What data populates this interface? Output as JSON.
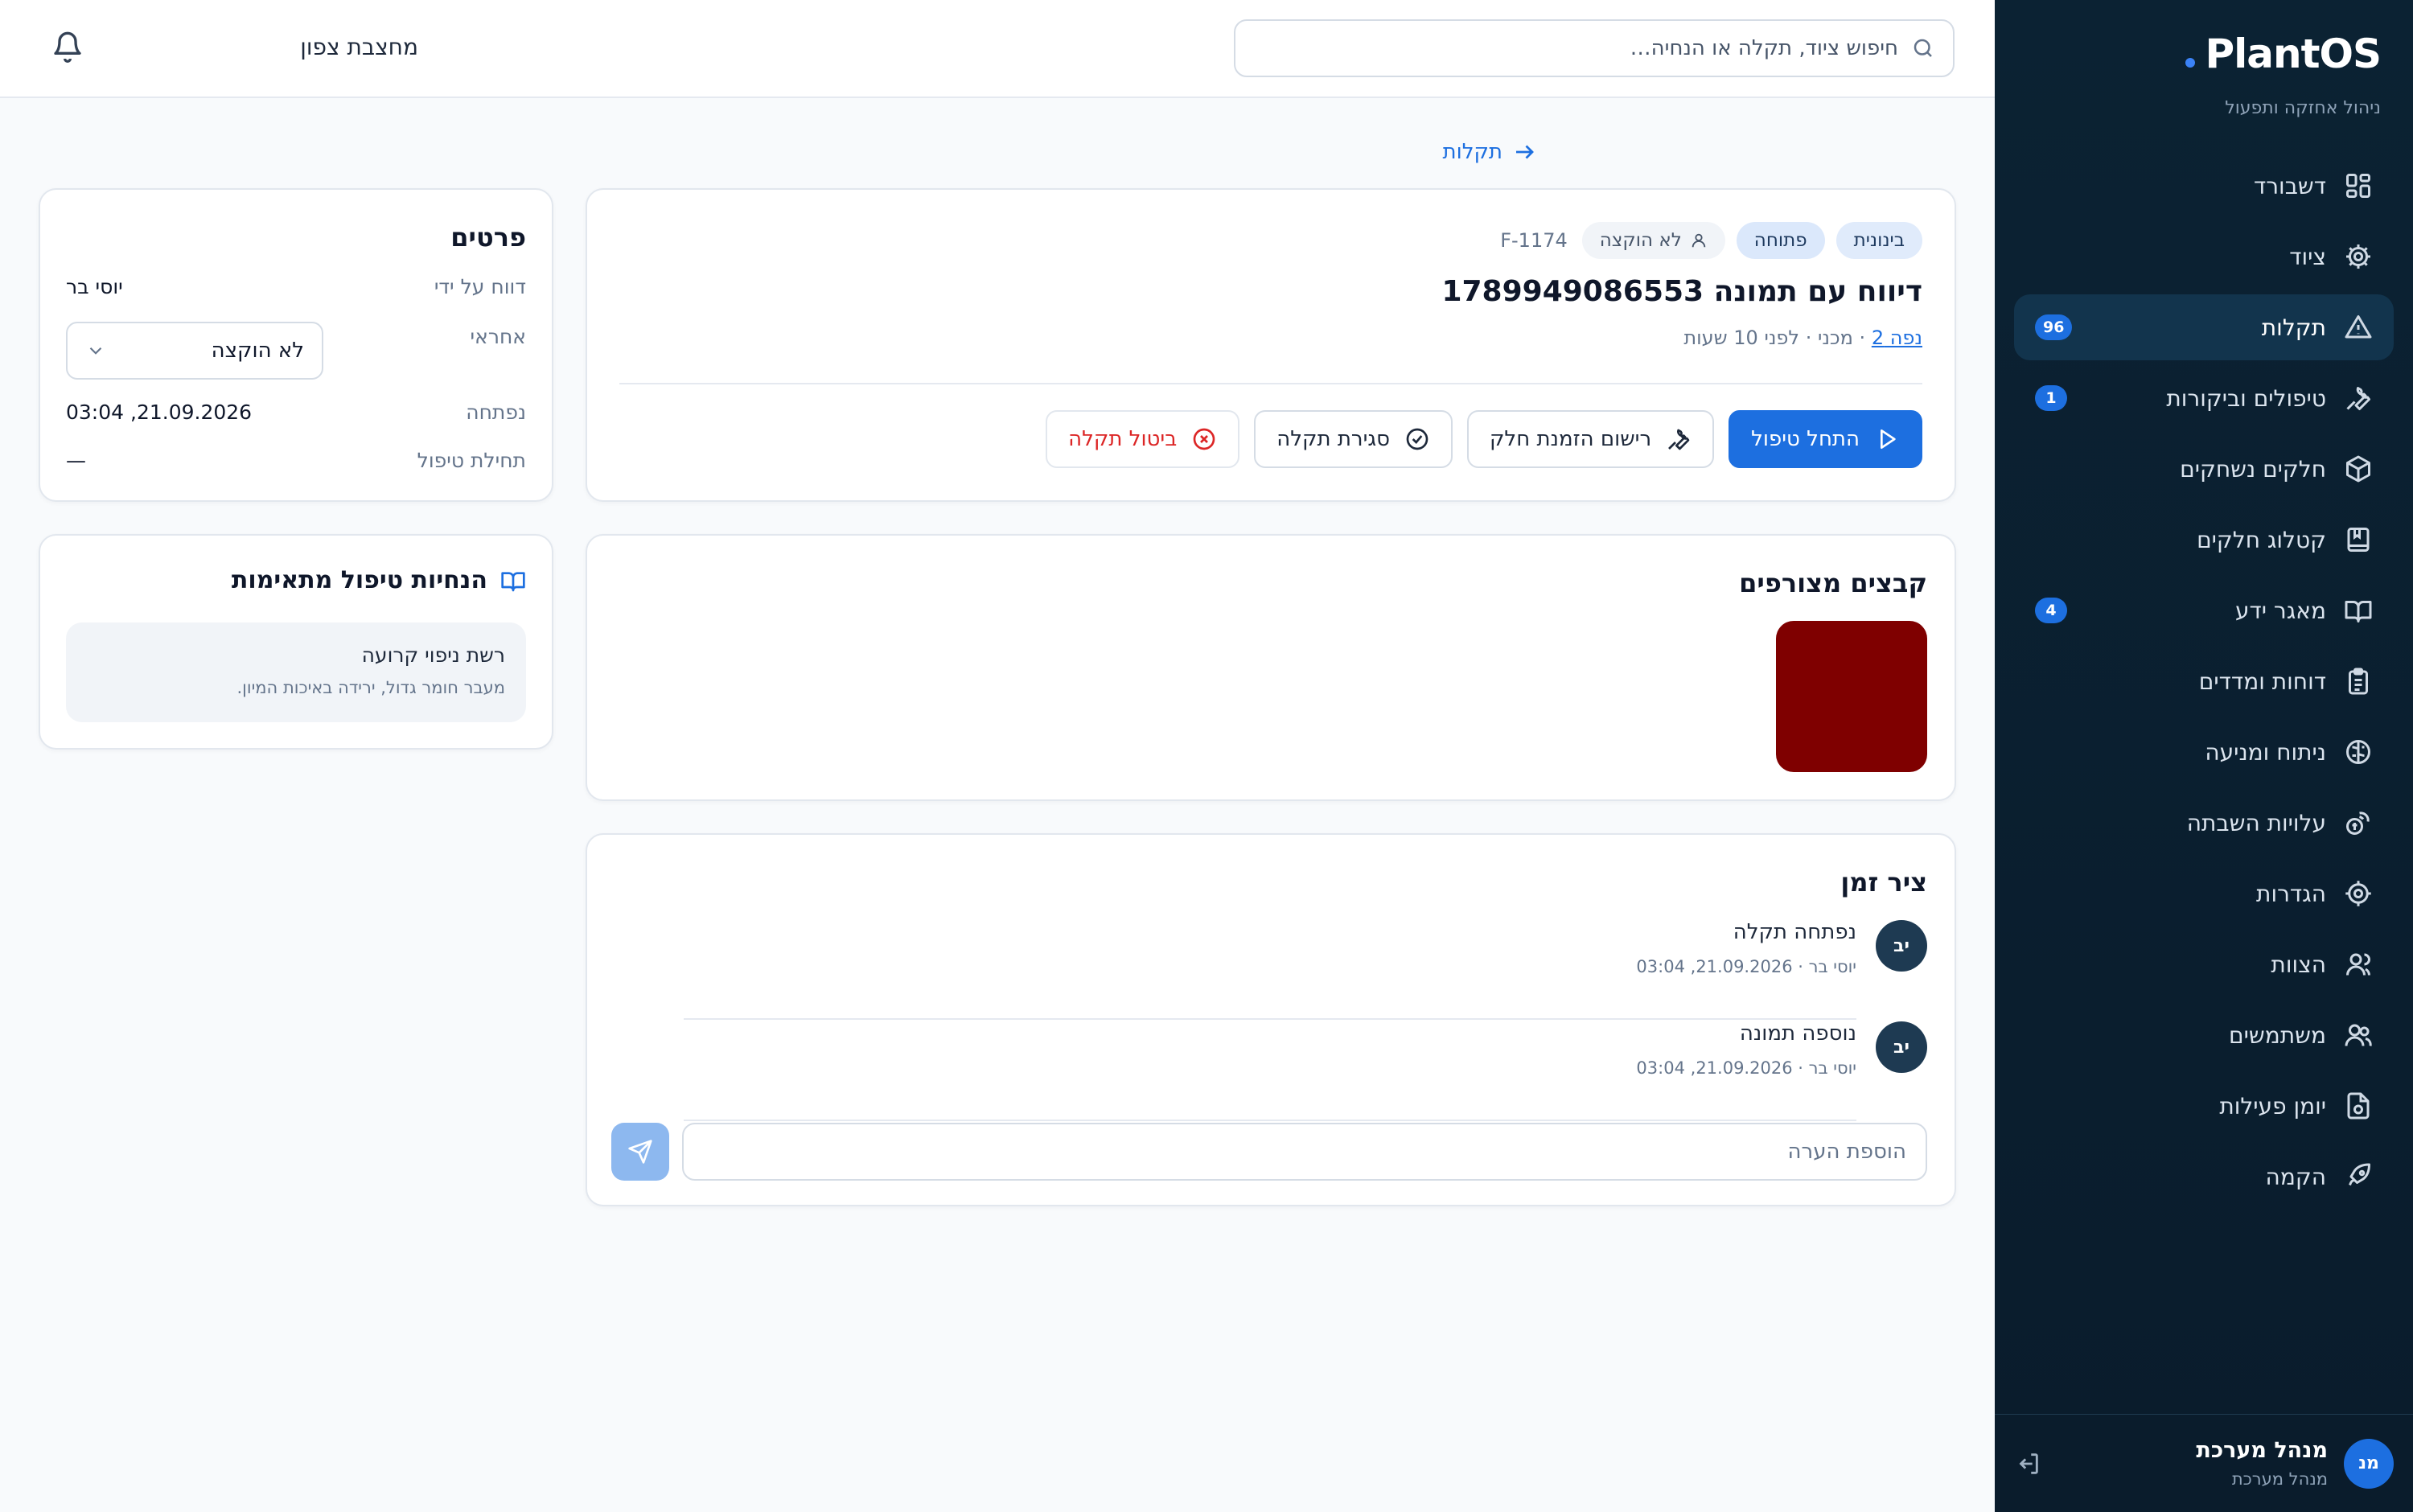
{
  "sidebar": {
    "brand": "PlantOS",
    "subtitle": "ניהול אחזקה ותפעול",
    "items": [
      {
        "label": "דשבורד",
        "icon": "dashboard-icon",
        "badge": ""
      },
      {
        "label": "ציוד",
        "icon": "gear-icon",
        "badge": ""
      },
      {
        "label": "תקלות",
        "icon": "warning-icon",
        "badge": "96",
        "active": true
      },
      {
        "label": "טיפולים וביקורות",
        "icon": "wrench-icon",
        "badge": "1"
      },
      {
        "label": "חלקים נשחקים",
        "icon": "box-icon",
        "badge": ""
      },
      {
        "label": "קטלוג חלקים",
        "icon": "book-icon",
        "badge": ""
      },
      {
        "label": "מאגר ידע",
        "icon": "open-book-icon",
        "badge": "4"
      },
      {
        "label": "דוחות ומדדים",
        "icon": "clipboard-icon",
        "badge": ""
      },
      {
        "label": "ניתוח ומניעה",
        "icon": "brain-icon",
        "badge": ""
      },
      {
        "label": "עלויות השבתה",
        "icon": "coins-icon",
        "badge": ""
      },
      {
        "label": "הגדרות",
        "icon": "settings-icon",
        "badge": ""
      },
      {
        "label": "הצוות",
        "icon": "user-icon",
        "badge": ""
      },
      {
        "label": "משתמשים",
        "icon": "users-icon",
        "badge": ""
      },
      {
        "label": "יומן פעילות",
        "icon": "activity-log-icon",
        "badge": ""
      },
      {
        "label": "הקמה",
        "icon": "rocket-icon",
        "badge": ""
      }
    ],
    "user": {
      "initials": "מנ",
      "name": "מנהל מערכת",
      "role": "מנהל מערכת"
    }
  },
  "topbar": {
    "search_placeholder": "חיפוש ציוד, תקלה או הנחיה…",
    "site": "מחצבת צפון"
  },
  "back_link": "תקלות",
  "fault": {
    "priority": "בינונית",
    "status": "פתוחה",
    "assignee": "לא הוקצה",
    "id": "F-1174",
    "title": "דיווח עם תמונה 1789949086553",
    "meta_link": "נפה 2",
    "meta_rest": " · מכני · לפני 10 שעות",
    "actions": {
      "start": "התחל טיפול",
      "order_part": "רישום הזמנת חלק",
      "close": "סגירת תקלה",
      "cancel": "ביטול תקלה"
    }
  },
  "files": {
    "title": "קבצים מצורפים",
    "thumb_color": "#7f0000"
  },
  "timeline": {
    "title": "ציר זמן",
    "items": [
      {
        "initials": "יב",
        "title": "נפתחה תקלה",
        "sub": "יוסי בר · 21.09.2026, 03:04"
      },
      {
        "initials": "יב",
        "title": "נוספה תמונה",
        "sub": "יוסי בר · 21.09.2026, 03:04"
      }
    ],
    "comment_placeholder": "הוספת הערה"
  },
  "details": {
    "title": "פרטים",
    "reported_by_label": "דווח על ידי",
    "reported_by": "יוסי בר",
    "responsible_label": "אחראי",
    "responsible": "לא הוקצה",
    "opened_label": "נפתחה",
    "opened": "21.09.2026, 03:04",
    "started_label": "תחילת טיפול",
    "started": "—"
  },
  "guides": {
    "title": "הנחיות טיפול מתאימות",
    "items": [
      {
        "name": "רשת ניפוי קרועה",
        "desc": "מעבר חומר גדול, ירידה באיכות המיון."
      }
    ]
  },
  "colors": {
    "sidebar_bg": "#0b2233",
    "accent": "#1d6fe0",
    "danger": "#dc2626"
  }
}
